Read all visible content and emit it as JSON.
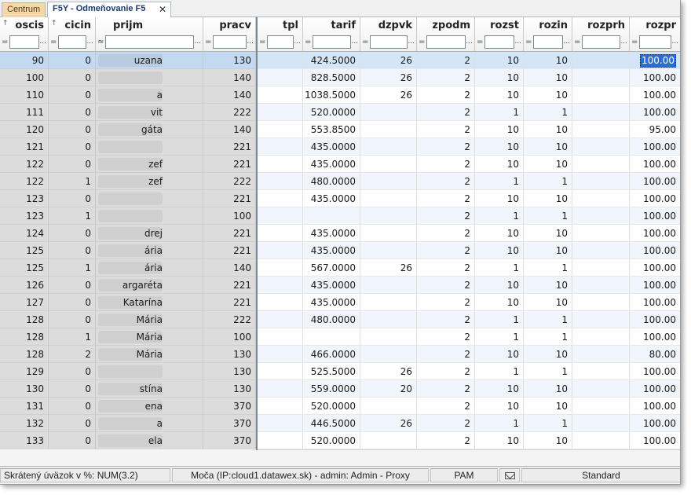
{
  "tabs": [
    {
      "label": "Centrum"
    },
    {
      "label": "F5Y - Odmeňovanie F5"
    }
  ],
  "close_glyph": "✕",
  "columns": [
    {
      "key": "oscis",
      "label": "oscis",
      "sort_icon": "↑",
      "filter_op": "="
    },
    {
      "key": "cicin",
      "label": "cicin",
      "sort_icon": "↑",
      "filter_op": "="
    },
    {
      "key": "prijm",
      "label": "prijm",
      "sort_icon": "",
      "filter_op": "≈"
    },
    {
      "key": "pracv",
      "label": "pracv",
      "sort_icon": "",
      "filter_op": "="
    },
    {
      "key": "tpl",
      "label": "tpl",
      "sort_icon": "",
      "filter_op": "="
    },
    {
      "key": "tarif",
      "label": "tarif",
      "sort_icon": "",
      "filter_op": "="
    },
    {
      "key": "dzpvk",
      "label": "dzpvk",
      "sort_icon": "",
      "filter_op": "="
    },
    {
      "key": "zpodm",
      "label": "zpodm",
      "sort_icon": "",
      "filter_op": "="
    },
    {
      "key": "rozst",
      "label": "rozst",
      "sort_icon": "",
      "filter_op": "="
    },
    {
      "key": "rozin",
      "label": "rozin",
      "sort_icon": "",
      "filter_op": "="
    },
    {
      "key": "rozprh",
      "label": "rozprh",
      "sort_icon": "",
      "filter_op": "="
    },
    {
      "key": "rozpr",
      "label": "rozpr",
      "sort_icon": "",
      "filter_op": "="
    }
  ],
  "filter_dots": "...",
  "rows": [
    {
      "oscis": "90",
      "cicin": "0",
      "prijm": "uzana",
      "pracv": "130",
      "tpl": "",
      "tarif": "424.5000",
      "dzpvk": "26",
      "zpodm": "2",
      "rozst": "10",
      "rozin": "10",
      "rozprh": "",
      "rozpr": "100.00"
    },
    {
      "oscis": "100",
      "cicin": "0",
      "prijm": "",
      "pracv": "140",
      "tpl": "",
      "tarif": "828.5000",
      "dzpvk": "26",
      "zpodm": "2",
      "rozst": "10",
      "rozin": "10",
      "rozprh": "",
      "rozpr": "100.00"
    },
    {
      "oscis": "110",
      "cicin": "0",
      "prijm": "a",
      "pracv": "140",
      "tpl": "",
      "tarif": "1038.5000",
      "dzpvk": "26",
      "zpodm": "2",
      "rozst": "10",
      "rozin": "10",
      "rozprh": "",
      "rozpr": "100.00"
    },
    {
      "oscis": "111",
      "cicin": "0",
      "prijm": "vit",
      "pracv": "222",
      "tpl": "",
      "tarif": "520.0000",
      "dzpvk": "",
      "zpodm": "2",
      "rozst": "1",
      "rozin": "1",
      "rozprh": "",
      "rozpr": "100.00"
    },
    {
      "oscis": "120",
      "cicin": "0",
      "prijm": "gáta",
      "pracv": "140",
      "tpl": "",
      "tarif": "553.8500",
      "dzpvk": "",
      "zpodm": "2",
      "rozst": "10",
      "rozin": "10",
      "rozprh": "",
      "rozpr": "95.00"
    },
    {
      "oscis": "121",
      "cicin": "0",
      "prijm": "",
      "pracv": "221",
      "tpl": "",
      "tarif": "435.0000",
      "dzpvk": "",
      "zpodm": "2",
      "rozst": "10",
      "rozin": "10",
      "rozprh": "",
      "rozpr": "100.00"
    },
    {
      "oscis": "122",
      "cicin": "0",
      "prijm": "zef",
      "pracv": "221",
      "tpl": "",
      "tarif": "435.0000",
      "dzpvk": "",
      "zpodm": "2",
      "rozst": "10",
      "rozin": "10",
      "rozprh": "",
      "rozpr": "100.00"
    },
    {
      "oscis": "122",
      "cicin": "1",
      "prijm": "zef",
      "pracv": "222",
      "tpl": "",
      "tarif": "480.0000",
      "dzpvk": "",
      "zpodm": "2",
      "rozst": "1",
      "rozin": "1",
      "rozprh": "",
      "rozpr": "100.00"
    },
    {
      "oscis": "123",
      "cicin": "0",
      "prijm": "",
      "pracv": "221",
      "tpl": "",
      "tarif": "435.0000",
      "dzpvk": "",
      "zpodm": "2",
      "rozst": "10",
      "rozin": "10",
      "rozprh": "",
      "rozpr": "100.00"
    },
    {
      "oscis": "123",
      "cicin": "1",
      "prijm": "",
      "pracv": "100",
      "tpl": "",
      "tarif": "",
      "dzpvk": "",
      "zpodm": "2",
      "rozst": "1",
      "rozin": "1",
      "rozprh": "",
      "rozpr": "100.00"
    },
    {
      "oscis": "124",
      "cicin": "0",
      "prijm": "drej",
      "pracv": "221",
      "tpl": "",
      "tarif": "435.0000",
      "dzpvk": "",
      "zpodm": "2",
      "rozst": "10",
      "rozin": "10",
      "rozprh": "",
      "rozpr": "100.00"
    },
    {
      "oscis": "125",
      "cicin": "0",
      "prijm": "ária",
      "pracv": "221",
      "tpl": "",
      "tarif": "435.0000",
      "dzpvk": "",
      "zpodm": "2",
      "rozst": "10",
      "rozin": "10",
      "rozprh": "",
      "rozpr": "100.00"
    },
    {
      "oscis": "125",
      "cicin": "1",
      "prijm": "ária",
      "pracv": "140",
      "tpl": "",
      "tarif": "567.0000",
      "dzpvk": "26",
      "zpodm": "2",
      "rozst": "1",
      "rozin": "1",
      "rozprh": "",
      "rozpr": "100.00"
    },
    {
      "oscis": "126",
      "cicin": "0",
      "prijm": "argaréta",
      "pracv": "221",
      "tpl": "",
      "tarif": "435.0000",
      "dzpvk": "",
      "zpodm": "2",
      "rozst": "10",
      "rozin": "10",
      "rozprh": "",
      "rozpr": "100.00"
    },
    {
      "oscis": "127",
      "cicin": "0",
      "prijm": "Katarína",
      "pracv": "221",
      "tpl": "",
      "tarif": "435.0000",
      "dzpvk": "",
      "zpodm": "2",
      "rozst": "10",
      "rozin": "10",
      "rozprh": "",
      "rozpr": "100.00"
    },
    {
      "oscis": "128",
      "cicin": "0",
      "prijm": "Mária",
      "pracv": "222",
      "tpl": "",
      "tarif": "480.0000",
      "dzpvk": "",
      "zpodm": "2",
      "rozst": "1",
      "rozin": "1",
      "rozprh": "",
      "rozpr": "100.00"
    },
    {
      "oscis": "128",
      "cicin": "1",
      "prijm": "Mária",
      "pracv": "100",
      "tpl": "",
      "tarif": "",
      "dzpvk": "",
      "zpodm": "2",
      "rozst": "1",
      "rozin": "1",
      "rozprh": "",
      "rozpr": "100.00"
    },
    {
      "oscis": "128",
      "cicin": "2",
      "prijm": "Mária",
      "pracv": "130",
      "tpl": "",
      "tarif": "466.0000",
      "dzpvk": "",
      "zpodm": "2",
      "rozst": "10",
      "rozin": "10",
      "rozprh": "",
      "rozpr": "80.00"
    },
    {
      "oscis": "129",
      "cicin": "0",
      "prijm": "",
      "pracv": "130",
      "tpl": "",
      "tarif": "525.5000",
      "dzpvk": "26",
      "zpodm": "2",
      "rozst": "1",
      "rozin": "1",
      "rozprh": "",
      "rozpr": "100.00"
    },
    {
      "oscis": "130",
      "cicin": "0",
      "prijm": "stína",
      "pracv": "130",
      "tpl": "",
      "tarif": "559.0000",
      "dzpvk": "20",
      "zpodm": "2",
      "rozst": "10",
      "rozin": "10",
      "rozprh": "",
      "rozpr": "100.00"
    },
    {
      "oscis": "131",
      "cicin": "0",
      "prijm": "ena",
      "pracv": "370",
      "tpl": "",
      "tarif": "520.0000",
      "dzpvk": "",
      "zpodm": "2",
      "rozst": "10",
      "rozin": "10",
      "rozprh": "",
      "rozpr": "100.00"
    },
    {
      "oscis": "132",
      "cicin": "0",
      "prijm": "a",
      "pracv": "370",
      "tpl": "",
      "tarif": "446.5000",
      "dzpvk": "26",
      "zpodm": "2",
      "rozst": "1",
      "rozin": "1",
      "rozprh": "",
      "rozpr": "100.00"
    },
    {
      "oscis": "133",
      "cicin": "0",
      "prijm": "ela",
      "pracv": "370",
      "tpl": "",
      "tarif": "520.0000",
      "dzpvk": "",
      "zpodm": "2",
      "rozst": "10",
      "rozin": "10",
      "rozprh": "",
      "rozpr": "100.00"
    }
  ],
  "selected_row": 0,
  "scroll_left_arrow": "<",
  "status": {
    "left": "Skrátený úväzok v %: NUM(3.2)",
    "connection": "Moča (IP:cloud1.datawex.sk) - admin: Admin - Proxy",
    "pam": "PAM",
    "mail_icon": "envelope-icon",
    "standard": "Standard"
  },
  "colors": {
    "selected_row": "#d4e5f7",
    "frozen_bg": "#dcdcdc",
    "alt_row": "#f1f6fd",
    "edit_cell": "#2a6fcf",
    "centrum_tab": "#f6d8a8"
  }
}
